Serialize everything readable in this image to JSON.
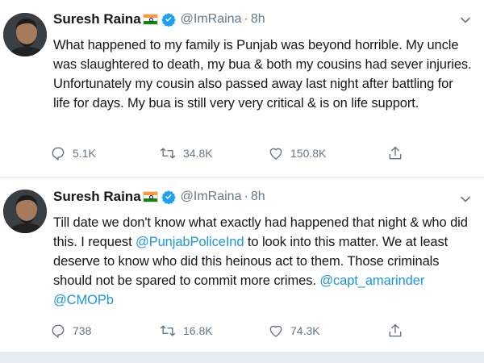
{
  "tweets": [
    {
      "display_name": "Suresh Raina",
      "handle": "@ImRaina",
      "separator": "·",
      "time": "8h",
      "text_parts": [
        {
          "text": "What happened to my family is Punjab was beyond horrible. My uncle was slaughtered to death, my bua & both my cousins had sever injuries. Unfortunately my cousin also passed away last night after battling for life for days. My bua is still very very critical & is on life support.",
          "mention": false
        }
      ],
      "replies": "5.1K",
      "retweets": "34.8K",
      "likes": "150.8K"
    },
    {
      "display_name": "Suresh Raina",
      "handle": "@ImRaina",
      "separator": "·",
      "time": "8h",
      "text_parts": [
        {
          "text": "Till date we don't know what exactly had happened that night & who did this. I request ",
          "mention": false
        },
        {
          "text": "@PunjabPoliceInd",
          "mention": true
        },
        {
          "text": " to look into this matter. We at least deserve to know who did this heinous act to them. Those criminals should not be spared to commit more crimes. ",
          "mention": false
        },
        {
          "text": "@capt_amarinder",
          "mention": true
        },
        {
          "text": " ",
          "mention": false
        },
        {
          "text": "@CMOPb",
          "mention": true
        }
      ],
      "replies": "738",
      "retweets": "16.8K",
      "likes": "74.3K"
    }
  ],
  "icons": {
    "verified": "verified-badge-icon",
    "caret": "chevron-down-icon",
    "reply": "reply-icon",
    "retweet": "retweet-icon",
    "like": "heart-icon",
    "share": "share-icon",
    "flag": "india-flag-icon"
  },
  "colors": {
    "accent": "#1b95e0",
    "muted": "#657786",
    "text": "#14171a"
  }
}
